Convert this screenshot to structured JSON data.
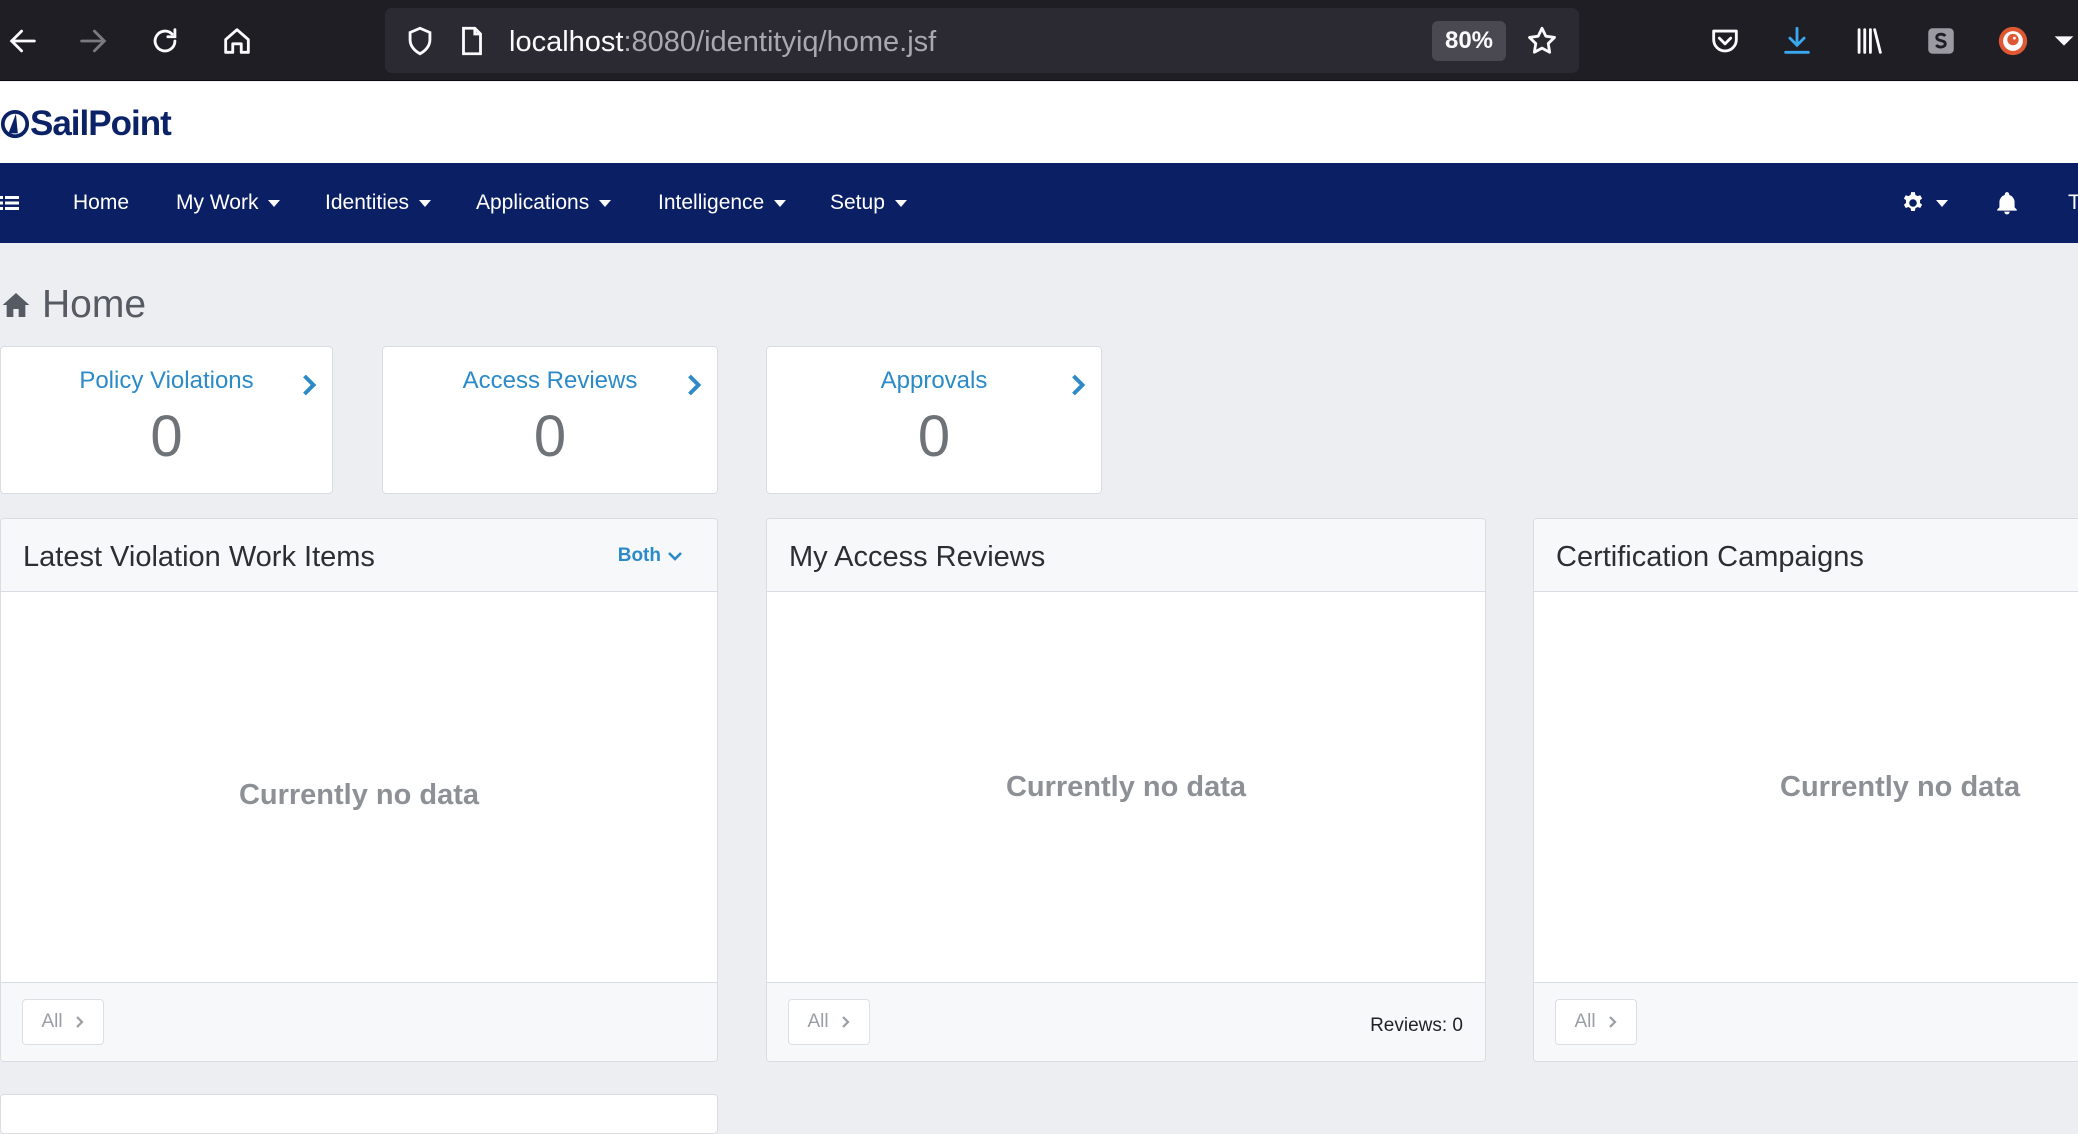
{
  "browser": {
    "url_host": "localhost",
    "url_path": ":8080/identityiq/home.jsf",
    "zoom": "80%"
  },
  "header": {
    "logo_text": "SailPoint"
  },
  "nav": {
    "items": [
      {
        "label": "Home",
        "has_dropdown": false
      },
      {
        "label": "My Work",
        "has_dropdown": true
      },
      {
        "label": "Identities",
        "has_dropdown": true
      },
      {
        "label": "Applications",
        "has_dropdown": true
      },
      {
        "label": "Intelligence",
        "has_dropdown": true
      },
      {
        "label": "Setup",
        "has_dropdown": true
      }
    ],
    "right_cut_text": "T"
  },
  "page": {
    "title": "Home"
  },
  "stats": [
    {
      "title": "Policy Violations",
      "value": "0"
    },
    {
      "title": "Access Reviews",
      "value": "0"
    },
    {
      "title": "Approvals",
      "value": "0"
    }
  ],
  "widgets": {
    "violations": {
      "title": "Latest Violation Work Items",
      "filter_label": "Both",
      "empty_text": "Currently no data",
      "all_label": "All"
    },
    "access_reviews": {
      "title": "My Access Reviews",
      "empty_text": "Currently no data",
      "all_label": "All",
      "reviews_count": "Reviews: 0"
    },
    "campaigns": {
      "title": "Certification Campaigns",
      "empty_text": "Currently no data",
      "all_label": "All"
    }
  },
  "colors": {
    "navbar": "#0b1f65",
    "link": "#2b8ac8",
    "page_bg": "#edeef1",
    "browser_bg": "#1f1e24"
  },
  "icons": [
    "back-icon",
    "forward-icon",
    "reload-icon",
    "home-icon",
    "shield-icon",
    "page-icon",
    "star-icon",
    "pocket-icon",
    "download-icon",
    "library-icon",
    "extension-s-icon",
    "duckduckgo-icon",
    "overflow-icon",
    "menu-icon",
    "gear-icon",
    "bell-icon",
    "home-page-icon",
    "chevron-right-icon",
    "chevron-down-icon"
  ]
}
